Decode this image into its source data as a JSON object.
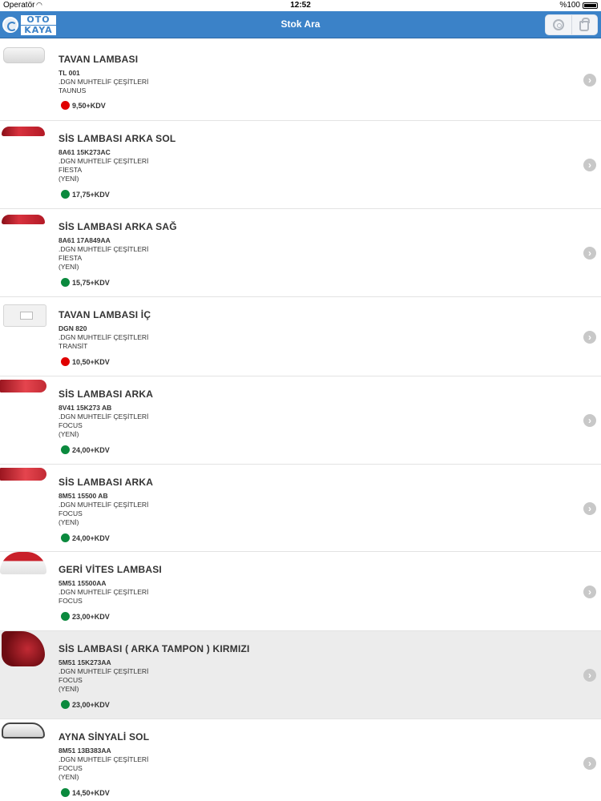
{
  "status_bar": {
    "carrier": "Operatör",
    "time": "12:52",
    "battery": "%100"
  },
  "nav": {
    "title": "Stok Ara",
    "logo_line1": "OTO",
    "logo_line2": "KAYA"
  },
  "items": [
    {
      "title": "TAVAN LAMBASI",
      "code": "TL 001",
      "group": ".DGN MUHTELİF ÇEŞİTLERİ",
      "model": "TAUNUS",
      "note": "",
      "price": "9,50+KDV",
      "stock": "red"
    },
    {
      "title": "SİS LAMBASI ARKA SOL",
      "code": "8A61 15K273AC",
      "group": ".DGN MUHTELİF ÇEŞİTLERİ",
      "model": "FİESTA",
      "note": "(YENİ)",
      "price": "17,75+KDV",
      "stock": "green"
    },
    {
      "title": "SİS LAMBASI ARKA SAĞ",
      "code": "8A61 17A849AA",
      "group": ".DGN MUHTELİF ÇEŞİTLERİ",
      "model": "FİESTA",
      "note": "(YENİ)",
      "price": "15,75+KDV",
      "stock": "green"
    },
    {
      "title": "TAVAN LAMBASI İÇ",
      "code": "DGN 820",
      "group": ".DGN MUHTELİF ÇEŞİTLERİ",
      "model": "TRANSİT",
      "note": "",
      "price": "10,50+KDV",
      "stock": "red"
    },
    {
      "title": "SİS LAMBASI ARKA",
      "code": "8V41 15K273 AB",
      "group": ".DGN MUHTELİF ÇEŞİTLERİ",
      "model": "FOCUS",
      "note": "(YENİ)",
      "price": "24,00+KDV",
      "stock": "green"
    },
    {
      "title": "SİS LAMBASI ARKA",
      "code": "8M51 15500 AB",
      "group": ".DGN MUHTELİF ÇEŞİTLERİ",
      "model": "FOCUS",
      "note": "(YENİ)",
      "price": "24,00+KDV",
      "stock": "green"
    },
    {
      "title": "GERİ VİTES LAMBASI",
      "code": "5M51 15500AA",
      "group": ".DGN MUHTELİF ÇEŞİTLERİ",
      "model": "FOCUS",
      "note": "",
      "price": "23,00+KDV",
      "stock": "green"
    },
    {
      "title": "SİS LAMBASI ( ARKA TAMPON ) KIRMIZI",
      "code": "5M51 15K273AA",
      "group": ".DGN MUHTELİF ÇEŞİTLERİ",
      "model": "FOCUS",
      "note": "(YENİ)",
      "price": "23,00+KDV",
      "stock": "green"
    },
    {
      "title": "AYNA SİNYALİ SOL",
      "code": "8M51 13B383AA",
      "group": ".DGN MUHTELİF ÇEŞİTLERİ",
      "model": "FOCUS",
      "note": "(YENİ)",
      "price": "14,50+KDV",
      "stock": "green"
    }
  ],
  "icons": {
    "stock_red": "#e00000",
    "stock_green": "#0b8a3e",
    "accent": "#3b82c8"
  }
}
